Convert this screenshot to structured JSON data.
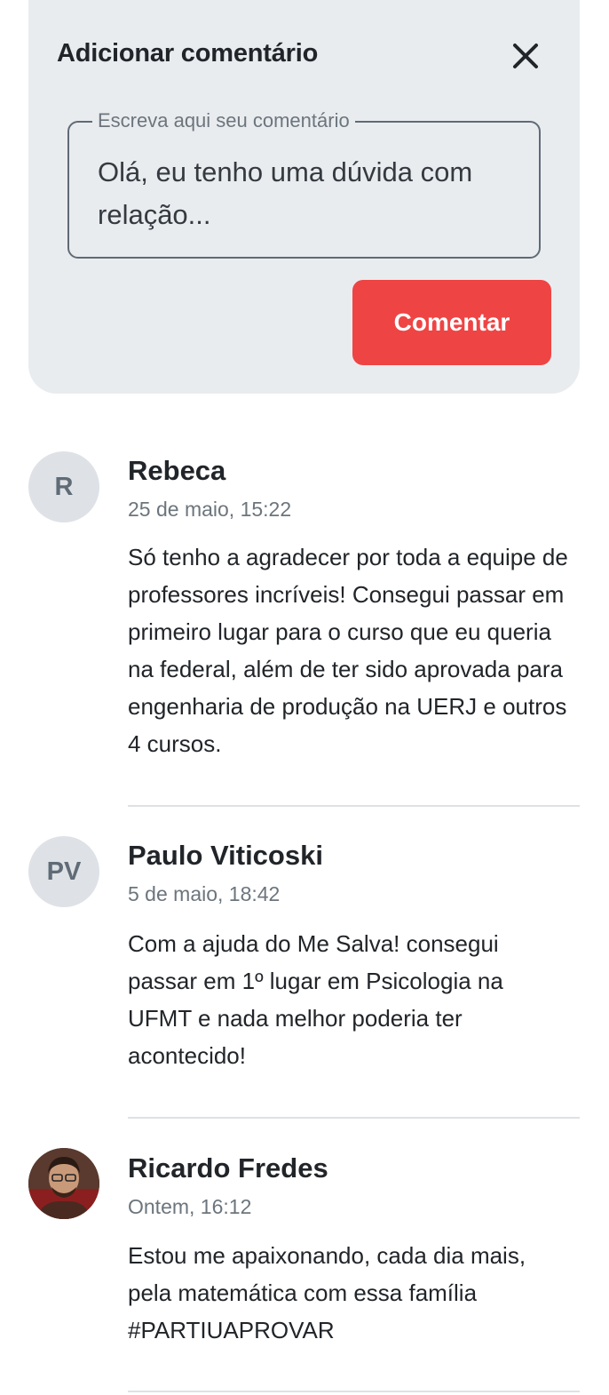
{
  "form": {
    "title": "Adicionar comentário",
    "field_label": "Escreva aqui seu comentário",
    "field_value": "Olá, eu tenho uma dúvida com relação...",
    "submit_label": "Comentar",
    "close_icon": "close-icon",
    "accent_color": "#ef4444"
  },
  "comments": [
    {
      "initials": "R",
      "author": "Rebeca",
      "date": "25 de maio, 15:22",
      "text": "Só tenho a agradecer por toda a equipe de professores incríveis! Consegui passar em primeiro lugar para o curso que eu queria na federal, além de ter sido aprovada para engenharia de produção na UERJ e outros 4 cursos."
    },
    {
      "initials": "PV",
      "author": "Paulo Viticoski",
      "date": "5 de maio, 18:42",
      "text": "Com a ajuda do Me Salva! consegui passar em 1º lugar em Psicologia na UFMT e nada melhor poderia ter acontecido!"
    },
    {
      "initials": "",
      "author": "Ricardo Fredes",
      "date": "Ontem, 16:12",
      "text": "Estou me apaixonando, cada dia mais, pela matemática com essa família #PARTIUAPROVAR"
    }
  ]
}
